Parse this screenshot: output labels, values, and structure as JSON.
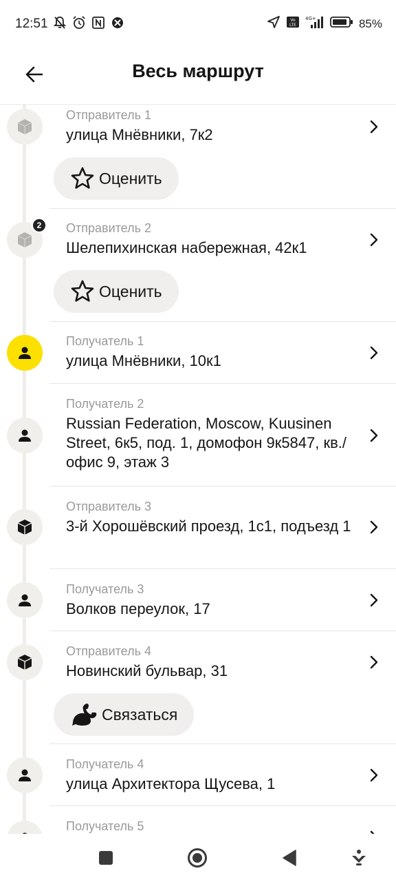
{
  "status_bar": {
    "time": "12:51",
    "battery": "85%",
    "icons": [
      "notifications-off-icon",
      "alarm-icon",
      "nfc-icon",
      "app-icon",
      "location-arrow-icon",
      "volte-icon",
      "signal-icon",
      "battery-icon"
    ]
  },
  "header": {
    "title": "Весь маршрут",
    "back_icon": "arrow-left-icon"
  },
  "stops": [
    {
      "label": "Отправитель 1",
      "address": "улица Мнёвники, 7к2",
      "type": "sender",
      "badge": "",
      "action": "Оценить"
    },
    {
      "label": "Отправитель 2",
      "address": "Шелепихинская набережная, 42к1",
      "type": "sender",
      "badge": "2",
      "action": "Оценить"
    },
    {
      "label": "Получатель 1",
      "address": "улица Мнёвники, 10к1",
      "type": "receiver",
      "active": true
    },
    {
      "label": "Получатель 2",
      "address": "Russian Federation, Moscow, Kuusinen Street, 6к5, под. 1, домофон 9к5847, кв./офис 9, этаж 3",
      "type": "receiver"
    },
    {
      "label": "Отправитель 3",
      "address": "3-й Хорошёвский проезд, 1с1, подъезд 1",
      "type": "sender"
    },
    {
      "label": "Получатель 3",
      "address": "Волков переулок, 17",
      "type": "receiver"
    },
    {
      "label": "Отправитель 4",
      "address": "Новинский бульвар, 31",
      "type": "sender",
      "action": "Связаться"
    },
    {
      "label": "Получатель 4",
      "address": "улица Архитектора Щусева, 1",
      "type": "receiver"
    },
    {
      "label": "Получатель 5",
      "address": "",
      "type": "receiver"
    }
  ],
  "nav_bar": {
    "icons": [
      "recents-square-icon",
      "home-circle-icon",
      "back-triangle-icon",
      "assistant-icon"
    ]
  },
  "colors": {
    "active_marker": "#fce000",
    "marker_bg": "#f1efec",
    "pill_bg": "#f0efed",
    "secondary_text": "#9a9a9a"
  }
}
